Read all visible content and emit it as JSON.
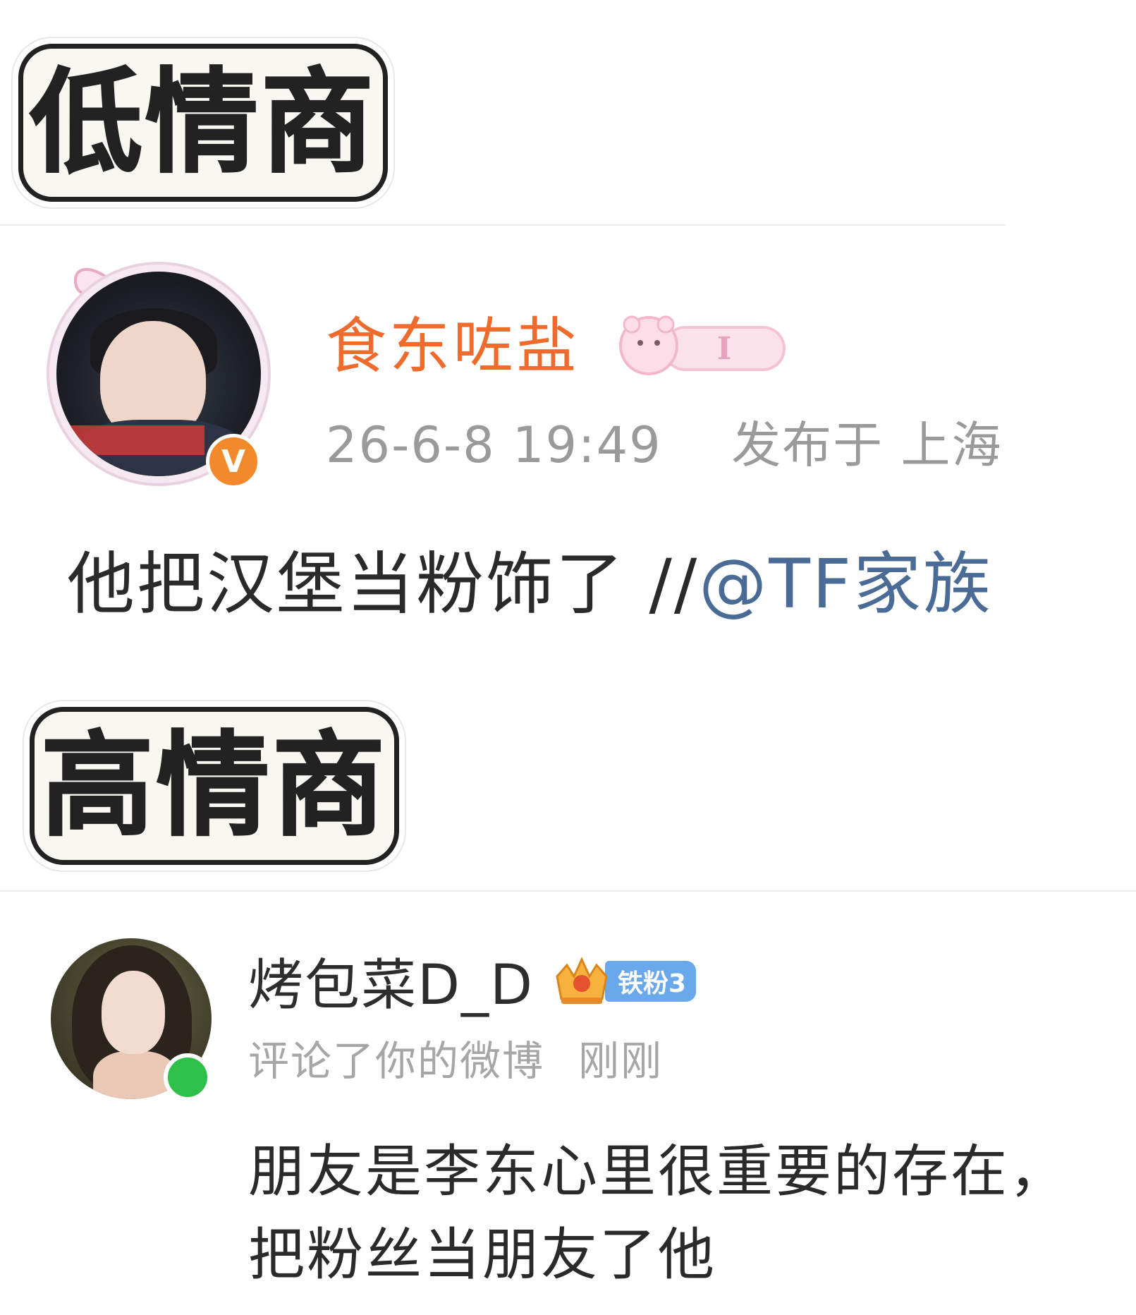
{
  "section1": {
    "label": "低情商",
    "username": "食东咗盐",
    "verified_badge": "V",
    "rank_badge_icon": "bear-level-badge",
    "timestamp": "26-6-8 19:49",
    "location": "发布于 上海",
    "post_text": "他把汉堡当粉饰了 //",
    "mention": "@TF家族"
  },
  "section2": {
    "label": "高情商",
    "username": "烤包菜D_D",
    "fan_badge": "铁粉3",
    "action": "评论了你的微博",
    "time": "刚刚",
    "comment": "朋友是李东心里很重要的存在，把粉丝当朋友了他"
  },
  "colors": {
    "username_orange": "#ee6b2d",
    "mention_blue": "#4a6b95",
    "meta_gray": "#9a9a9a",
    "verified_orange": "#f28a2b",
    "online_green": "#2fc04a",
    "fan_badge_blue": "#6aa8ec"
  }
}
